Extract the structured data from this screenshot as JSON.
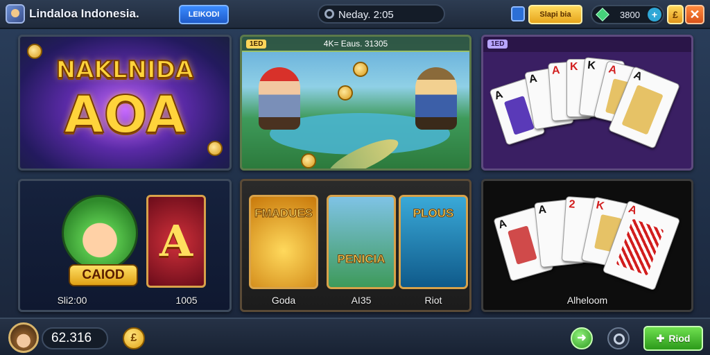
{
  "topbar": {
    "app_title": "Lindaloa Indonesia.",
    "tab_label": "LEIKODI",
    "clock_text": "Neday. 2:05",
    "gold_button_label": "Slapi bia",
    "gem_value": "3800",
    "coin_button_label": "£",
    "close_label": "✕"
  },
  "tiles": {
    "t1": {
      "title_top": "NAKLNIDA",
      "title_big": "AOA"
    },
    "t2": {
      "tag": "1ED",
      "header": "4K= Eaus. 31305"
    },
    "t3": {
      "tag": "1ED"
    },
    "t4": {
      "badge": "CAIOD",
      "big_letter": "A",
      "left_label": "Sli2:00",
      "right_label": "1005"
    },
    "t5": {
      "slots": [
        {
          "title": "FMADUES",
          "label": "Goda"
        },
        {
          "title": "PENICIA",
          "label": "AI35"
        },
        {
          "title": "PLOUS",
          "label": "Riot"
        }
      ]
    },
    "t6": {
      "label": "Alheloom"
    }
  },
  "bottombar": {
    "balance": "62.316",
    "coin_symbol": "£",
    "share_symbol": "➜",
    "play_label": "Riod",
    "play_symbol": "✚"
  },
  "colors": {
    "accent_gold": "#ffd43b",
    "accent_green": "#2c9a1a",
    "accent_blue": "#1f5bc9"
  }
}
